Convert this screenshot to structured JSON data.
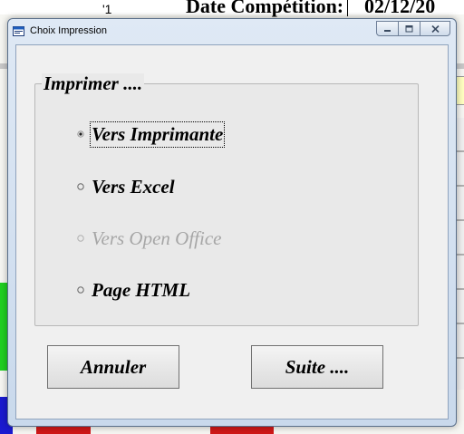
{
  "background": {
    "header_label": "Date Compétition:",
    "header_value": "02/12/20",
    "tick_text": "'1"
  },
  "window": {
    "title": "Choix Impression",
    "icons": {
      "app": "window-app-icon",
      "minimize": "minimize-icon",
      "maximize": "maximize-icon",
      "close": "close-icon"
    }
  },
  "group": {
    "label": "Imprimer ...."
  },
  "options": [
    {
      "label": "Vers Imprimante",
      "selected": true,
      "enabled": true
    },
    {
      "label": "Vers Excel",
      "selected": false,
      "enabled": true
    },
    {
      "label": "Vers Open Office",
      "selected": false,
      "enabled": false
    },
    {
      "label": "Page HTML",
      "selected": false,
      "enabled": true
    }
  ],
  "buttons": {
    "cancel_label": "Annuler",
    "next_label": "Suite ...."
  }
}
